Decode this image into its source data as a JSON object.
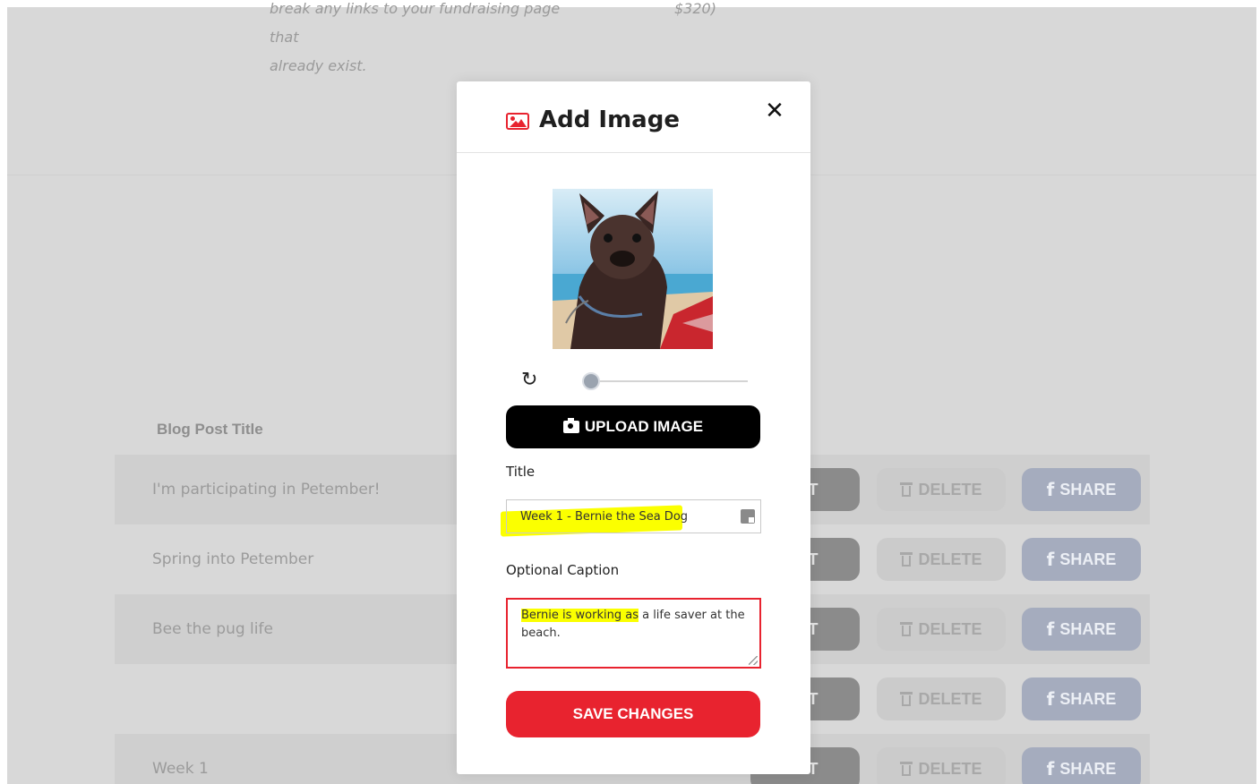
{
  "background": {
    "intro_line_1": "break any links to your fundraising page that",
    "intro_line_2": "already exist.",
    "intro_amount": "$320)"
  },
  "blog_table": {
    "column_header": "Blog Post Title",
    "rows": [
      {
        "title": "I'm participating in Petember!"
      },
      {
        "title": "Spring into Petember"
      },
      {
        "title": "Bee the pug life"
      },
      {
        "title": ""
      },
      {
        "title": "Week 1"
      }
    ],
    "edit_label": "DIT",
    "delete_label": "DELETE",
    "share_label": "SHARE"
  },
  "modal": {
    "title": "Add Image",
    "upload_label": "UPLOAD IMAGE",
    "title_label": "Title",
    "title_value": "Week 1 - Bernie the Sea Dog",
    "caption_label": "Optional Caption",
    "caption_highlighted": "Bernie is working as",
    "caption_rest": " a life saver at the beach.",
    "rotation_fraction": 0.0,
    "save_label": "SAVE CHANGES"
  },
  "colors": {
    "accent_red": "#e8232f",
    "highlight_yellow": "#fbff00",
    "overlay_gray": "#d8d8d8"
  },
  "icons": {
    "modal_title_icon": "image-icon",
    "close": "close-icon",
    "rotate": "rotate-icon",
    "upload": "camera-icon",
    "delete": "trash-icon",
    "share": "facebook-icon"
  }
}
